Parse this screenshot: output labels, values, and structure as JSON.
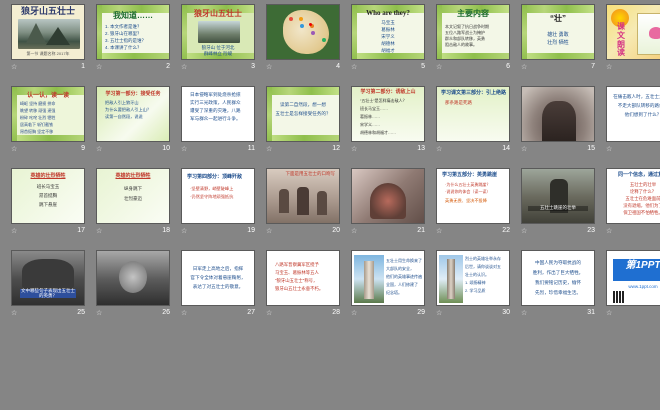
{
  "slides": [
    {
      "no": "1",
      "bg": "#f4eed2",
      "title": "狼牙山五壮士",
      "sub": "第一节 课题名称 2017年"
    },
    {
      "no": "2",
      "bg": "#f3f7e7",
      "title": "我知道……",
      "lines": [
        "1. 本文作者是谁？",
        "2. 狼牙山在哪里？",
        "3. 五壮士指的是谁？",
        "4. 本课讲了什么？"
      ]
    },
    {
      "no": "3",
      "bg": "#d9e9b6",
      "title": "狼牙山五壮士",
      "lines": [
        "狼牙山 位于河北",
        "群峰林立 险峻"
      ]
    },
    {
      "no": "4",
      "bg": "#3d6b35",
      "title": ""
    },
    {
      "no": "5",
      "bg": "#f3f7e7",
      "title": "Who are they?",
      "lines": [
        "马宝玉",
        "葛振林",
        "宋学义",
        "胡德林",
        "胡福才"
      ]
    },
    {
      "no": "6",
      "bg": "#f3f7e7",
      "title": "主要内容",
      "lines": [
        "本文记叙了抗日战争时期",
        "五位八路军战士为掩护",
        "群众和部队转移，英勇",
        "阻击敌人的故事。"
      ]
    },
    {
      "no": "7",
      "bg": "#f3f7e7",
      "title": "“壮”",
      "lines": [
        "雄壮 勇敢",
        "壮烈 牺牲"
      ]
    },
    {
      "no": "8",
      "bg": "#f6eab4",
      "title": "课文朗读"
    },
    {
      "no": "9",
      "bg": "#eef6da",
      "title": "认一认，读一读",
      "lines": [
        "崎岖 坚持 磨损 拼命",
        "眺望 转移 顽强 逞强",
        "粉碎 叱咤 壮烈 牺牲",
        "居高临下 斩钉截铁",
        "昂首挺胸 坚定不移"
      ]
    },
    {
      "no": "10",
      "bg": "#ecf5d6",
      "title": "学习第一部分：接受任务",
      "lines": [
        "把敌人引上狼牙山",
        "为什么要把敌人引上山？",
        "读第一自然段，说说"
      ]
    },
    {
      "no": "11",
      "bg": "#ffffff",
      "lines": [
        "日本侵略军到处烧杀抢掠",
        "实行三光政策，人民群众",
        "遭受了深重的灾难，八路",
        "军与群众一起进行斗争。"
      ]
    },
    {
      "no": "12",
      "bg": "#f3f7e7",
      "lines": [
        "读第二自然段，想一想",
        "五壮士是怎样接受任务的？"
      ]
    },
    {
      "no": "13",
      "bg": "#f3f7e7",
      "title": "学习第二部分：诱敌上山",
      "lines": [
        "“五壮士”是怎样痛击敌人？",
        "班长马宝玉……",
        "葛振林……",
        "宋学义……",
        "胡德林和胡福才……"
      ]
    },
    {
      "no": "14",
      "bg": "#f3f7e7",
      "title": "学习课文第三部分：引上绝路",
      "lines": [
        "那条路是死路"
      ]
    },
    {
      "no": "15",
      "bg": "#9a8f8a",
      "title": ""
    },
    {
      "no": "16",
      "bg": "#ffffff",
      "lines": [
        "在痛击敌人时，五壮士为什么",
        "不走大部队转移的路线？",
        "他们想到了什么？"
      ]
    },
    {
      "no": "17",
      "bg": "#f3f7e7",
      "title": "英雄的壮烈牺牲",
      "lines": [
        "班长马宝玉",
        "昂首挺胸",
        "跳下悬崖"
      ]
    },
    {
      "no": "18",
      "bg": "#f3f7e7",
      "title": "英雄的壮烈牺牲",
      "lines": [
        "纵身跳下",
        "壮烈豪迈"
      ]
    },
    {
      "no": "19",
      "bg": "#ffffff",
      "title": "学习第四部分：顶峰歼敌",
      "lines": [
        "·坚壁清野，峭壁陡峰上",
        "·仍然坚守阵地顽强抵抗"
      ]
    },
    {
      "no": "20",
      "bg": "#c8b9ad",
      "title": "下面是用五壮士的口吻写"
    },
    {
      "no": "21",
      "bg": "#8f7a73",
      "title": ""
    },
    {
      "no": "22",
      "bg": "#ffffff",
      "title": "学习第五部分：英勇跳崖",
      "lines": [
        "·为什么五壮士英勇跳崖？",
        "·说说你的体会（读一读）"
      ],
      "extra": "英勇无畏、坚决不投降"
    },
    {
      "no": "23",
      "bg": "#6a6a5e",
      "title": "五壮士跳崖的壮举"
    },
    {
      "no": "24",
      "bg": "#ffffff",
      "title": "同一个信念，通过复述",
      "lines": [
        "五壮士的壮举",
        "诠释了什么？",
        "五壮士在危难面前",
        "没有退缩，他们为了",
        "保卫祖国不怕牺牲。"
      ]
    },
    {
      "no": "25",
      "bg": "#4d4d4d",
      "title": "文中哪些句子表现出五壮士的英勇？"
    },
    {
      "no": "26",
      "bg": "#5c5c5c",
      "title": ""
    },
    {
      "no": "27",
      "bg": "#ffffff",
      "lines": [
        "日军走上高地之后，指挥",
        "官下令全体对着悬崖鞠躬，",
        "表达了对五壮士的敬意。"
      ]
    },
    {
      "no": "28",
      "bg": "#ffffff",
      "lines": [
        "八路军晋察冀军区授予",
        "马宝玉、葛振林等五人",
        "“狼牙山五壮士”称号，",
        "狼牙山五壮士永垂不朽。"
      ]
    },
    {
      "no": "29",
      "bg": "#ffffff",
      "lines": [
        "五壮士用生命换来了",
        "大部队的安全，",
        "他们的英雄事迹传遍",
        "全国，人们修建了",
        "纪念塔。"
      ]
    },
    {
      "no": "30",
      "bg": "#ffffff",
      "lines": [
        "烈士的英雄壮举永存",
        "后世，请你谈谈对五",
        "壮士的认识。",
        "1. 颂扬精神",
        "2. 学习品质"
      ]
    },
    {
      "no": "31",
      "bg": "#ffffff",
      "lines": [
        "中国人民为夺取抗战的",
        "胜利，作出了巨大牺牲。",
        "我们要铭记历史，缅怀",
        "先烈，珍惜幸福生活。"
      ]
    },
    {
      "no": "32",
      "bg": "#ffffff",
      "title": "第1PPT",
      "sub": "www.1ppt.com"
    }
  ]
}
